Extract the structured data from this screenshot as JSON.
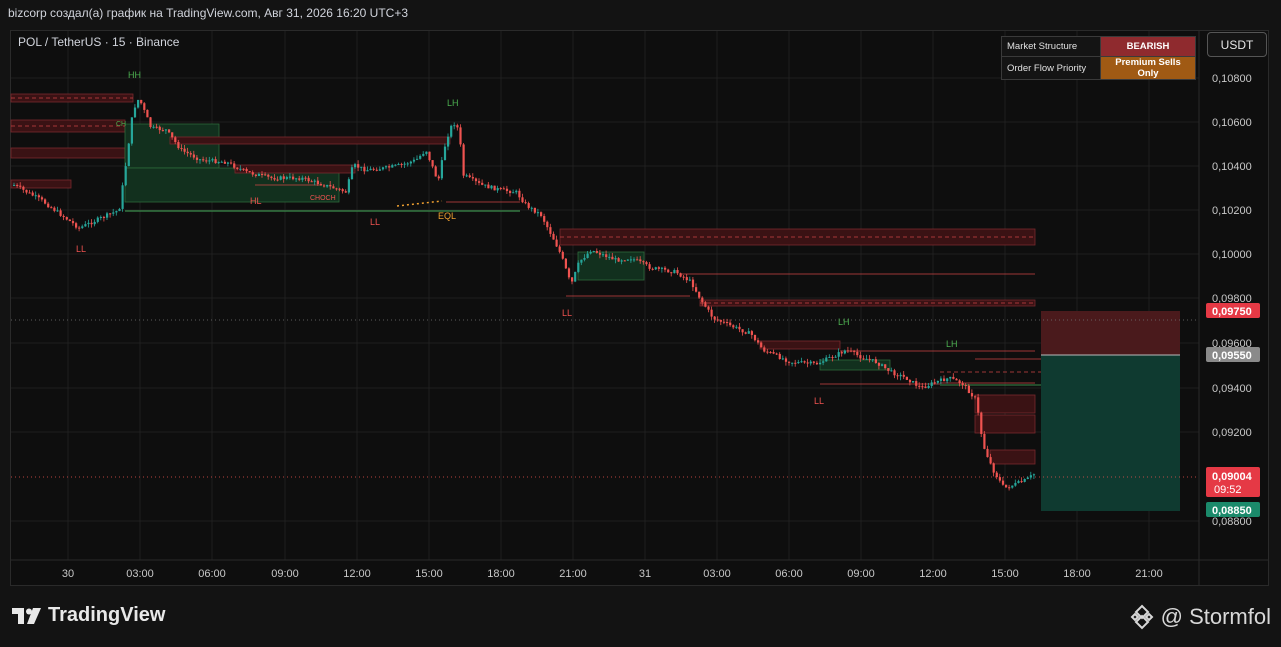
{
  "header": {
    "title": "bizcorp создал(а) график на TradingView.com, Авг 31, 2026 16:20 UTC+3"
  },
  "symbol": {
    "label": "POL / TetherUS · 15 · Binance"
  },
  "currency_button": "USDT",
  "market_table": {
    "row1_key": "Market Structure",
    "row1_value": "BEARISH",
    "row2_key": "Order Flow Priority",
    "row2_value": "Premium Sells Only"
  },
  "price_axis": [
    "0,10800",
    "0,10600",
    "0,10400",
    "0,10200",
    "0,10000",
    "0,09800",
    "0,09600",
    "0,09400",
    "0,09200",
    "0,08800"
  ],
  "time_axis": [
    "30",
    "03:00",
    "06:00",
    "09:00",
    "12:00",
    "15:00",
    "18:00",
    "21:00",
    "31",
    "03:00",
    "06:00",
    "09:00",
    "12:00",
    "15:00",
    "18:00",
    "21:00"
  ],
  "price_tags": {
    "sl": "0,09750",
    "entry": "0,09550",
    "last": "0,09004",
    "countdown": "09:52",
    "tp": "0,08850"
  },
  "structure_labels": {
    "hh": "HH",
    "lh1": "LH",
    "lh2": "LH",
    "lh3": "LH",
    "ll1": "LL",
    "ll2": "LL",
    "ll3": "LL",
    "ll4": "LL",
    "hl": "HL",
    "eql": "EQL",
    "choch": "CHOCH",
    "ch": "CH"
  },
  "colors": {
    "bull": "#26a69a",
    "bear": "#ef5350",
    "bg": "#131313",
    "sl_zone": "#4a1a1c",
    "tp_zone": "#0f3a30"
  },
  "footer": {
    "brand": "TradingView",
    "watermark": "@ Stormfol"
  }
}
